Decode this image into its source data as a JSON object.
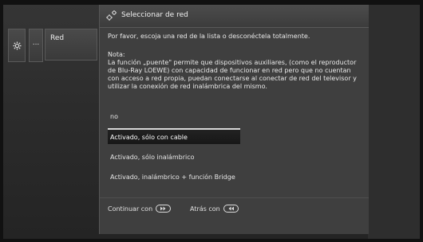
{
  "left_menu": {
    "tile_dots_label": "...",
    "tile_red_label": "Red"
  },
  "dialog": {
    "title": "Seleccionar de red",
    "intro": "Por favor, escoja una red de la lista o desconéctela totalmente.",
    "note_label": "Nota:",
    "note_text": "La función „puente\" permite que dispositivos auxiliares, (como el reproductor de Blu-Ray LOEWE) con capacidad de funcionar en red pero que no cuentan con acceso a red propia, puedan conectarse al conectar de red del televisor y utilizar la conexión de red inalámbrica del mismo.",
    "options": [
      {
        "label": "no"
      },
      {
        "label": "Activado, sólo con cable"
      },
      {
        "label": "Activado, sólo inalámbrico"
      },
      {
        "label": "Activado, inalámbrico + función Bridge"
      }
    ],
    "selected_index": 1
  },
  "footer": {
    "continue_label": "Continuar con",
    "continue_icon": "forward-key-icon",
    "back_label": "Atrás con",
    "back_icon": "rewind-key-icon"
  }
}
